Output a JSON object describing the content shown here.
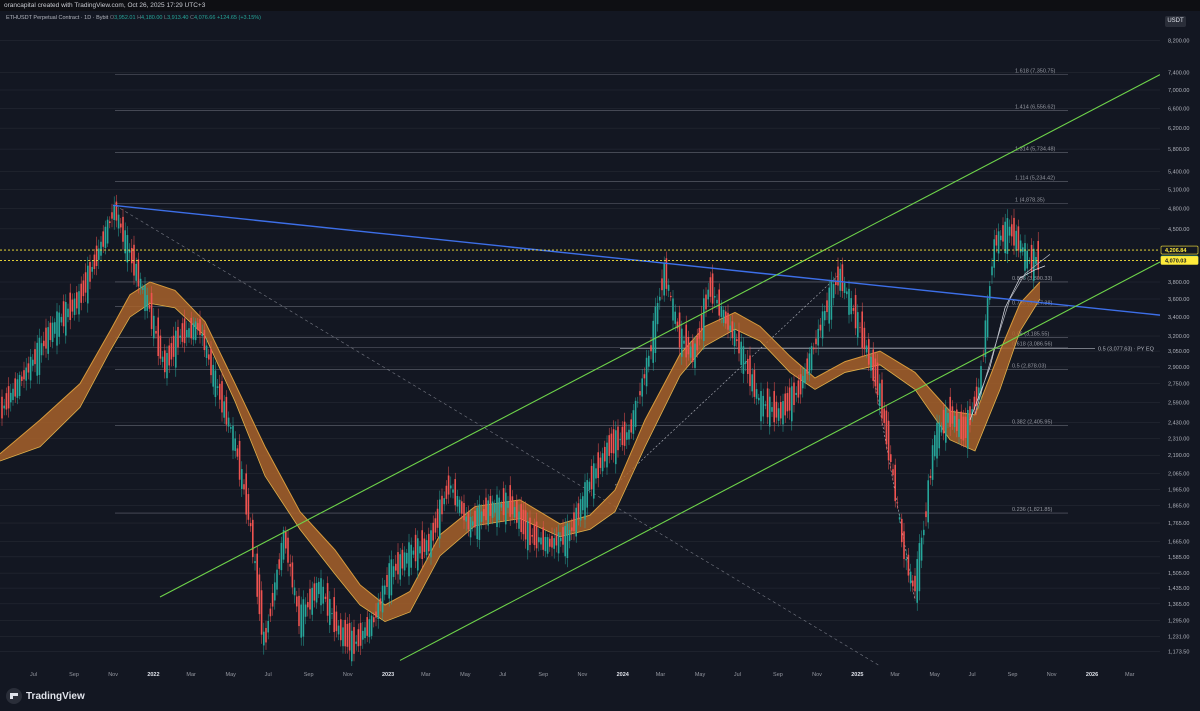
{
  "header": {
    "attribution": "orancapital created with TradingView.com, Oct 26, 2025 17:29 UTC+3"
  },
  "legend": {
    "symbol": "ETHUSDT Perpetual Contract · 1D · Bybit",
    "o_label": "O",
    "o": "3,952.01",
    "h_label": "H",
    "h": "4,180.00",
    "l_label": "L",
    "l": "3,913.40",
    "c_label": "C",
    "c": "4,076.66",
    "change": "+124.65 (+3.15%)"
  },
  "currency_badge": "USDT",
  "brand": "TradingView",
  "colors": {
    "up": "#26a69a",
    "down": "#ef5350",
    "trendline": "#3d6fe8",
    "channel": "#6ed34a",
    "ribbon": "#a8622a",
    "ribbon_edge": "#d79a3c",
    "level": "#ffeb3b",
    "grid": "#2a2e39"
  },
  "chart_data": {
    "type": "candlestick",
    "symbol": "ETHUSDT",
    "timeframe": "1D",
    "y_scale": "log",
    "ylim": [
      1120,
      9000
    ],
    "price_ticks": [
      "8,200.00",
      "7,400.00",
      "7,000.00",
      "6,600.00",
      "6,200.00",
      "5,800.00",
      "5,400.00",
      "5,100.00",
      "4,800.00",
      "4,500.00",
      "3,800.00",
      "3,600.00",
      "3,400.00",
      "3,200.00",
      "3,050.00",
      "2,900.00",
      "2,750.00",
      "2,590.00",
      "2,430.00",
      "2,310.00",
      "2,190.00",
      "2,065.00",
      "1,965.00",
      "1,865.00",
      "1,765.00",
      "1,665.00",
      "1,585.00",
      "1,505.00",
      "1,435.00",
      "1,365.00",
      "1,295.00",
      "1,231.00",
      "1,173.50"
    ],
    "time_ticks": [
      "Jul",
      "Sep",
      "Nov",
      "2022",
      "Mar",
      "May",
      "Jul",
      "Sep",
      "Nov",
      "2023",
      "Mar",
      "May",
      "Jul",
      "Sep",
      "Nov",
      "2024",
      "Mar",
      "May",
      "Jul",
      "Sep",
      "Nov",
      "2025",
      "Mar",
      "May",
      "Jul",
      "Sep",
      "Nov",
      "2026",
      "Mar"
    ],
    "price_labels": [
      {
        "text": "4,206.84",
        "value": 4206.84,
        "style": "outline"
      },
      {
        "text": "4,076.66",
        "value": 4076.66,
        "style": "last"
      },
      {
        "text": "4,070.03",
        "value": 4070.03,
        "style": "level"
      }
    ],
    "horizontal_levels": [
      4206.84,
      4070.03
    ],
    "fib_levels": [
      {
        "label": "1.618 (7,350.75)",
        "value": 7350.75
      },
      {
        "label": "1.414 (6,556.62)",
        "value": 6556.62
      },
      {
        "label": "1.314 (5,734.48)",
        "value": 5734.48
      },
      {
        "label": "1.114 (5,234.42)",
        "value": 5234.42
      },
      {
        "label": "1 (4,878.35)",
        "value": 4878.35
      },
      {
        "label": "0.886 (3,800.33)",
        "value": 3800.33
      },
      {
        "label": "0.786 (3,517.38)",
        "value": 3517.38
      },
      {
        "label": "0.66 (3,185.55)",
        "value": 3185.55
      },
      {
        "label": "0.618 (3,086.56)",
        "value": 3086.56
      },
      {
        "label": "0.5 (2,878.03)",
        "value": 2878.03
      },
      {
        "label": "0.382 (2,405.95)",
        "value": 2405.95
      },
      {
        "label": "0.236 (1,821.85)",
        "value": 1821.85
      }
    ],
    "annotations": [
      {
        "text": "0.5 (3,077.63) · PY EQ",
        "value": 3077.63
      }
    ],
    "candles": [
      [
        4.2,
        13.0
      ],
      [
        0.1,
        12.0
      ],
      [
        3.3,
        10.0
      ],
      [
        4.3,
        16.0
      ],
      [
        -1.0,
        16.0
      ],
      [
        -1.3,
        10.0
      ],
      [
        3.6,
        11.0
      ],
      [
        -2.5,
        11.0
      ],
      [
        -2.9,
        6.0
      ],
      [
        1.3,
        9.0
      ],
      [
        2.1,
        15.0
      ],
      [
        -1.6,
        17.0
      ],
      [
        2.1,
        12.0
      ],
      [
        -3.3,
        14.0
      ],
      [
        -0.4,
        10.0
      ],
      [
        3.1,
        14.0
      ],
      [
        -4.8,
        14.0
      ],
      [
        -5.5,
        16.0
      ],
      [
        -1.4,
        13.0
      ],
      [
        1.5,
        16.0
      ],
      [
        4.1,
        16.0
      ],
      [
        -3.8,
        11.0
      ],
      [
        3.5,
        12.0
      ],
      [
        -2.6,
        11.0
      ],
      [
        -1.4,
        7.0
      ],
      [
        -5.2,
        15.0
      ],
      [
        -3.6,
        13.0
      ],
      [
        -0.5,
        6.0
      ],
      [
        4.6,
        12.0
      ],
      [
        -5.1,
        14.0
      ],
      [
        -1.0,
        9.0
      ],
      [
        5.0,
        16.0
      ],
      [
        2.4,
        11.0
      ],
      [
        -2.3,
        10.0
      ],
      [
        3.1,
        11.0
      ],
      [
        -3.4,
        13.0
      ],
      [
        4.1,
        13.0
      ],
      [
        3.5,
        12.0
      ],
      [
        4.3,
        16.0
      ],
      [
        -5.3,
        16.0
      ]
    ]
  }
}
